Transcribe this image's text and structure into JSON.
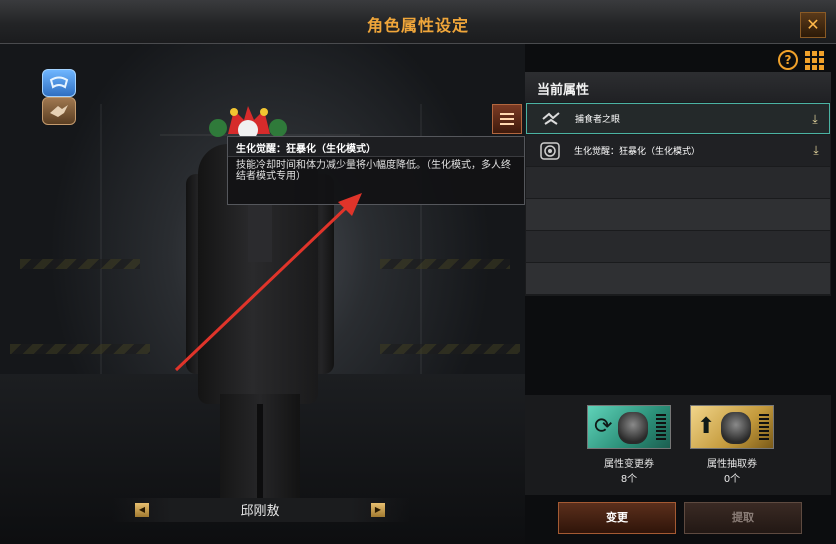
{
  "window": {
    "title": "角色属性设定",
    "close_icon": "close-icon"
  },
  "scene": {
    "mode_icons": [
      "controller-icon",
      "eagle-icon"
    ],
    "character_name": "邱刚敖"
  },
  "tooltip": {
    "title": "生化觉醒：狂暴化（生化模式）",
    "body": "技能冷却时间和体力减少量将小幅度降低。（生化模式，多人终结者模式专用）"
  },
  "panel": {
    "header": "当前属性",
    "attributes": [
      {
        "name": "捕食者之眼",
        "icon": "eye-icon",
        "equip_icon": "equip-icon",
        "selected": true
      },
      {
        "name": "生化觉醒：狂暴化（生化模式）",
        "icon": "spiral-icon",
        "equip_icon": "equip-icon",
        "selected": false
      }
    ]
  },
  "vouchers": [
    {
      "label": "属性变更券",
      "count": "8个",
      "color": "#3fb59a"
    },
    {
      "label": "属性抽取券",
      "count": "0个",
      "color": "#d9b35a"
    }
  ],
  "buttons": {
    "change": "变更",
    "extract": "提取"
  },
  "colors": {
    "title": "#f0a63a",
    "accent": "#f0a12a",
    "selected_border": "#4bb3a3",
    "arrow": "#e0342a"
  }
}
